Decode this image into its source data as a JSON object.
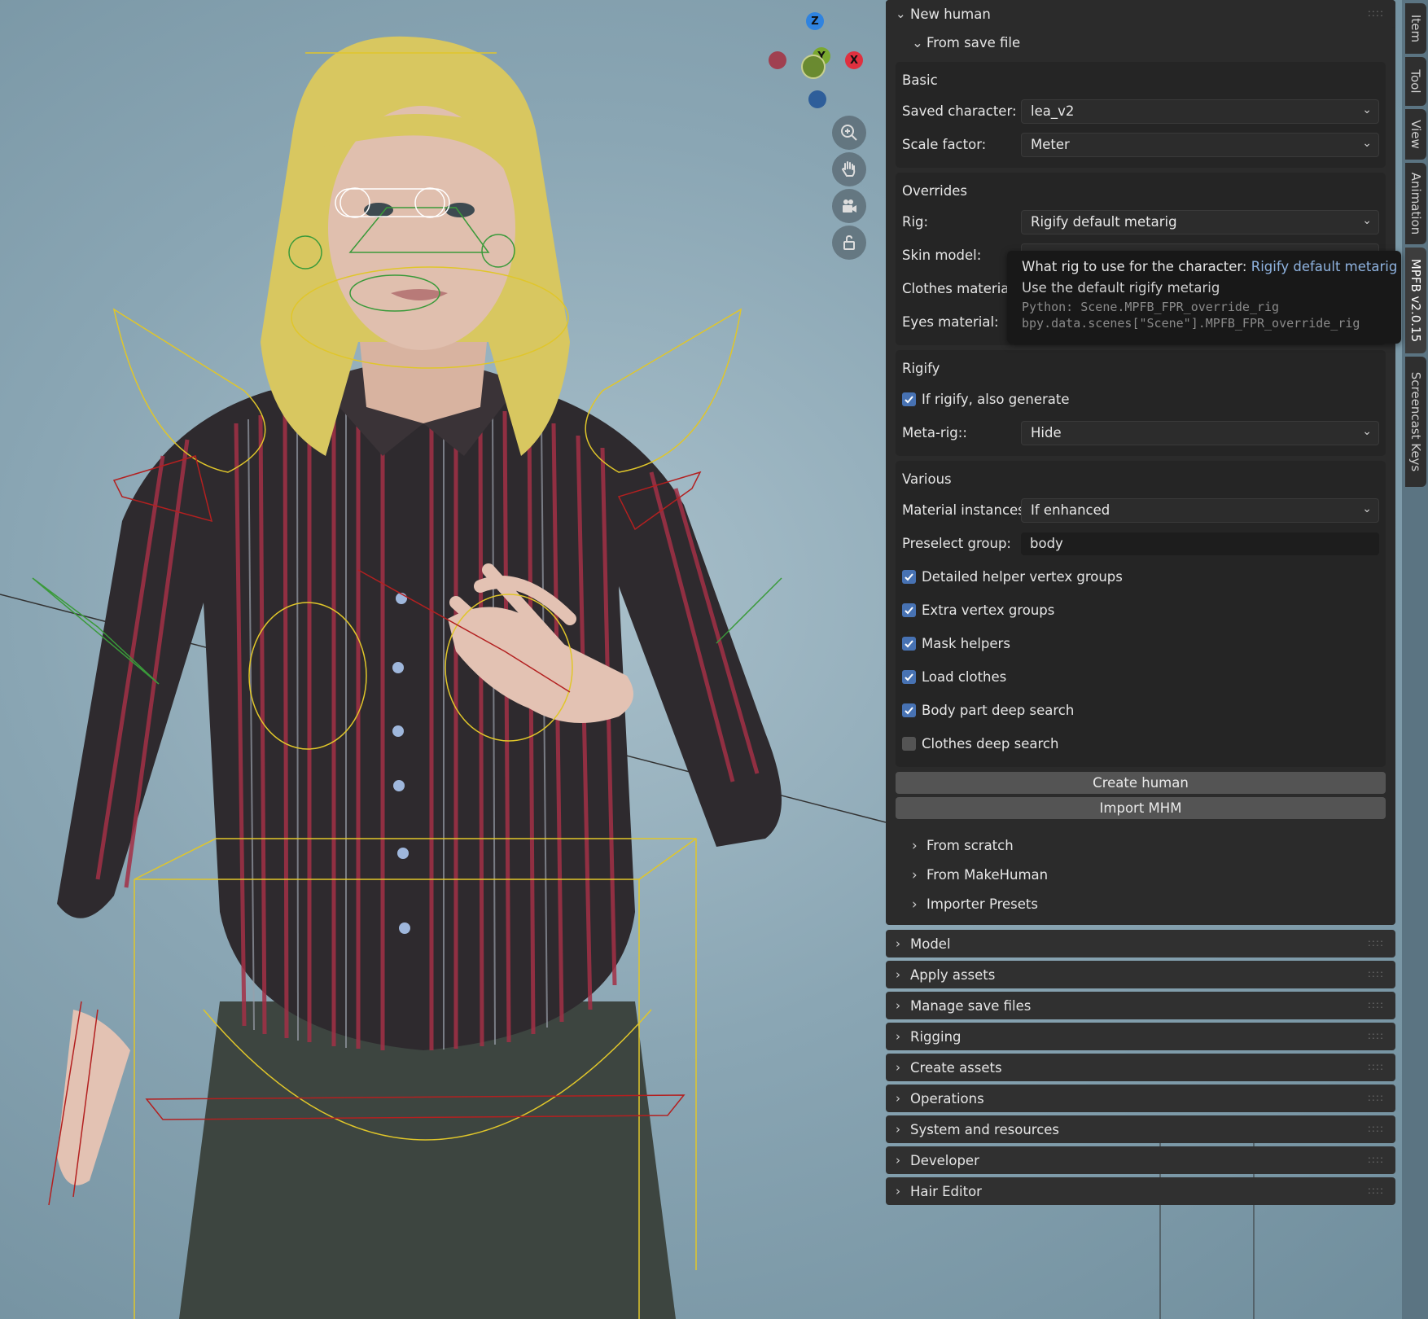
{
  "gizmo": {
    "z": "Z",
    "y": "Y",
    "x": "X"
  },
  "tabs": [
    "Item",
    "Tool",
    "View",
    "Animation",
    "MPFB v2.0.15",
    "Screencast Keys"
  ],
  "panel": {
    "new_human": "New human",
    "from_save_file": "From save file",
    "basic": {
      "title": "Basic",
      "saved_character_label": "Saved character:",
      "saved_character_value": "lea_v2",
      "scale_factor_label": "Scale factor:",
      "scale_factor_value": "Meter"
    },
    "overrides": {
      "title": "Overrides",
      "rig_label": "Rig:",
      "rig_value": "Rigify default metarig",
      "skin_model_label": "Skin model:",
      "clothes_material_label": "Clothes material:",
      "eyes_material_label": "Eyes material:"
    },
    "rigify": {
      "title": "Rigify",
      "also_generate_label": "If rigify, also generate",
      "also_generate_checked": true,
      "metarig_label": "Meta-rig::",
      "metarig_value": "Hide"
    },
    "various": {
      "title": "Various",
      "material_instances_label": "Material instances:",
      "material_instances_value": "If enhanced",
      "preselect_group_label": "Preselect group:",
      "preselect_group_value": "body",
      "options": [
        {
          "label": "Detailed helper vertex groups",
          "checked": true
        },
        {
          "label": "Extra vertex groups",
          "checked": true
        },
        {
          "label": "Mask helpers",
          "checked": true
        },
        {
          "label": "Load clothes",
          "checked": true
        },
        {
          "label": "Body part deep search",
          "checked": true
        },
        {
          "label": "Clothes deep search",
          "checked": false
        }
      ]
    },
    "buttons": {
      "create_human": "Create human",
      "import_mhm": "Import MHM"
    },
    "subsections": [
      "From scratch",
      "From MakeHuman",
      "Importer Presets"
    ],
    "sections": [
      "Model",
      "Apply assets",
      "Manage save files",
      "Rigging",
      "Create assets",
      "Operations",
      "System and resources",
      "Developer",
      "Hair Editor"
    ],
    "grip_dots": "::::"
  },
  "tooltip": {
    "line1_prefix": "What rig to use for the character: ",
    "line1_value": "Rigify default metarig",
    "line2": "Use the default rigify metarig",
    "python1": "Python: Scene.MPFB_FPR_override_rig",
    "python2": "bpy.data.scenes[\"Scene\"].MPFB_FPR_override_rig"
  },
  "colors": {
    "panel_bg": "#2b2b2b",
    "checkbox_on": "#4772b3",
    "tooltip_highlight": "#8fb3e0",
    "gizmo_x": "#e0303f",
    "gizmo_y": "#7aa830",
    "gizmo_z": "#2f83e0"
  }
}
